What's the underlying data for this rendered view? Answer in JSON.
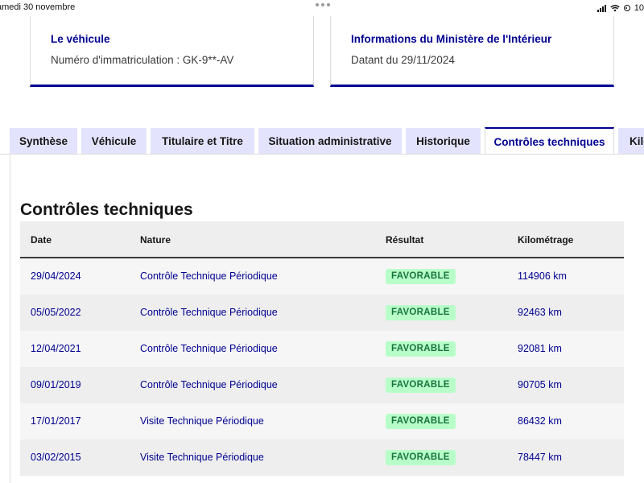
{
  "status_bar": {
    "date": "amedi 30 novembre",
    "battery_text": "10"
  },
  "vehicle_card": {
    "title": "Le véhicule",
    "text": "Numéro d'immatriculation : GK-9**-AV"
  },
  "ministry_card": {
    "title": "Informations du Ministère de l'Intérieur",
    "text": "Datant du 29/11/2024"
  },
  "tabs": [
    {
      "label": "Synthèse",
      "active": false
    },
    {
      "label": "Véhicule",
      "active": false
    },
    {
      "label": "Titulaire et Titre",
      "active": false
    },
    {
      "label": "Situation administrative",
      "active": false
    },
    {
      "label": "Historique",
      "active": false
    },
    {
      "label": "Contrôles techniques",
      "active": true
    },
    {
      "label": "Kilo",
      "active": false
    }
  ],
  "section": {
    "title": "Contrôles techniques"
  },
  "table": {
    "headers": [
      "Date",
      "Nature",
      "Résultat",
      "Kilométrage"
    ],
    "rows": [
      {
        "date": "29/04/2024",
        "nature": "Contrôle Technique Périodique",
        "result": "FAVORABLE",
        "km": "114906 km"
      },
      {
        "date": "05/05/2022",
        "nature": "Contrôle Technique Périodique",
        "result": "FAVORABLE",
        "km": "92463 km"
      },
      {
        "date": "12/04/2021",
        "nature": "Contrôle Technique Périodique",
        "result": "FAVORABLE",
        "km": "92081 km"
      },
      {
        "date": "09/01/2019",
        "nature": "Contrôle Technique Périodique",
        "result": "FAVORABLE",
        "km": "90705 km"
      },
      {
        "date": "17/01/2017",
        "nature": "Visite Technique Périodique",
        "result": "FAVORABLE",
        "km": "86432 km"
      },
      {
        "date": "03/02/2015",
        "nature": "Visite Technique Périodique",
        "result": "FAVORABLE",
        "km": "78447 km"
      }
    ]
  },
  "colors": {
    "primary": "#000091",
    "tab_background": "#e3e3fd",
    "badge_background": "#b8fec9",
    "badge_text": "#18753c"
  }
}
